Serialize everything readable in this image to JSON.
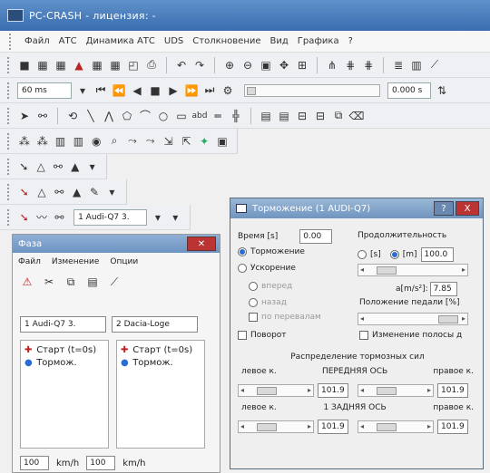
{
  "window": {
    "title": "PC-CRASH - лицензия: -"
  },
  "menubar": {
    "items": [
      "Файл",
      "АТС",
      "Динамика АТС",
      "UDS",
      "Столкновение",
      "Вид",
      "Графика",
      "?"
    ]
  },
  "toolbars": {
    "time_field": "60 ms",
    "time_value": "0.000 s",
    "vehicle_combo": "1 Audi-Q7 3."
  },
  "left_panel": {
    "title": "Фаза",
    "menu": [
      "Файл",
      "Изменение",
      "Опции"
    ],
    "combo_1": "1 Audi-Q7 3.",
    "combo_2": "2 Dacia-Loge",
    "list_1": [
      "Старт (t=0s)",
      "Тормож."
    ],
    "list_2": [
      "Старт (t=0s)",
      "Тормож."
    ],
    "bottom_field_1": "100",
    "bottom_unit_1": "km/h",
    "bottom_field_2": "100",
    "bottom_unit_2": "km/h"
  },
  "dialog": {
    "title": "Торможение (1 AUDI-Q7)",
    "help_label": "?",
    "close_label": "X",
    "time_label": "Время [s]",
    "time_value": "0.00",
    "duration_label": "Продолжительность",
    "brake_label": "Торможение",
    "accel_label": "Ускорение",
    "unit_s": "[s]",
    "unit_m": "[m]",
    "duration_value": "100.0",
    "forward_label": "вперед",
    "back_label": "назад",
    "transfer_label": "по перевалам",
    "accel_value_label": "a[m/s²]:",
    "accel_value": "7.85",
    "pedal_label": "Положение педали [%]",
    "turn_label": "Поворот",
    "lane_label": "Изменение полосы д",
    "distribution_title": "Распределение тормозных сил",
    "front_left": "левое к.",
    "front_axle": "ПЕРЕДНЯЯ ОСЬ",
    "front_right": "правое к.",
    "rear_left": "левое к.",
    "rear_axle": "1 ЗАДНЯЯ ОСЬ",
    "rear_right": "правое к.",
    "val_fl": "101.9",
    "val_fr": "101.9",
    "val_rl": "101.9",
    "val_rr": "101.9"
  }
}
